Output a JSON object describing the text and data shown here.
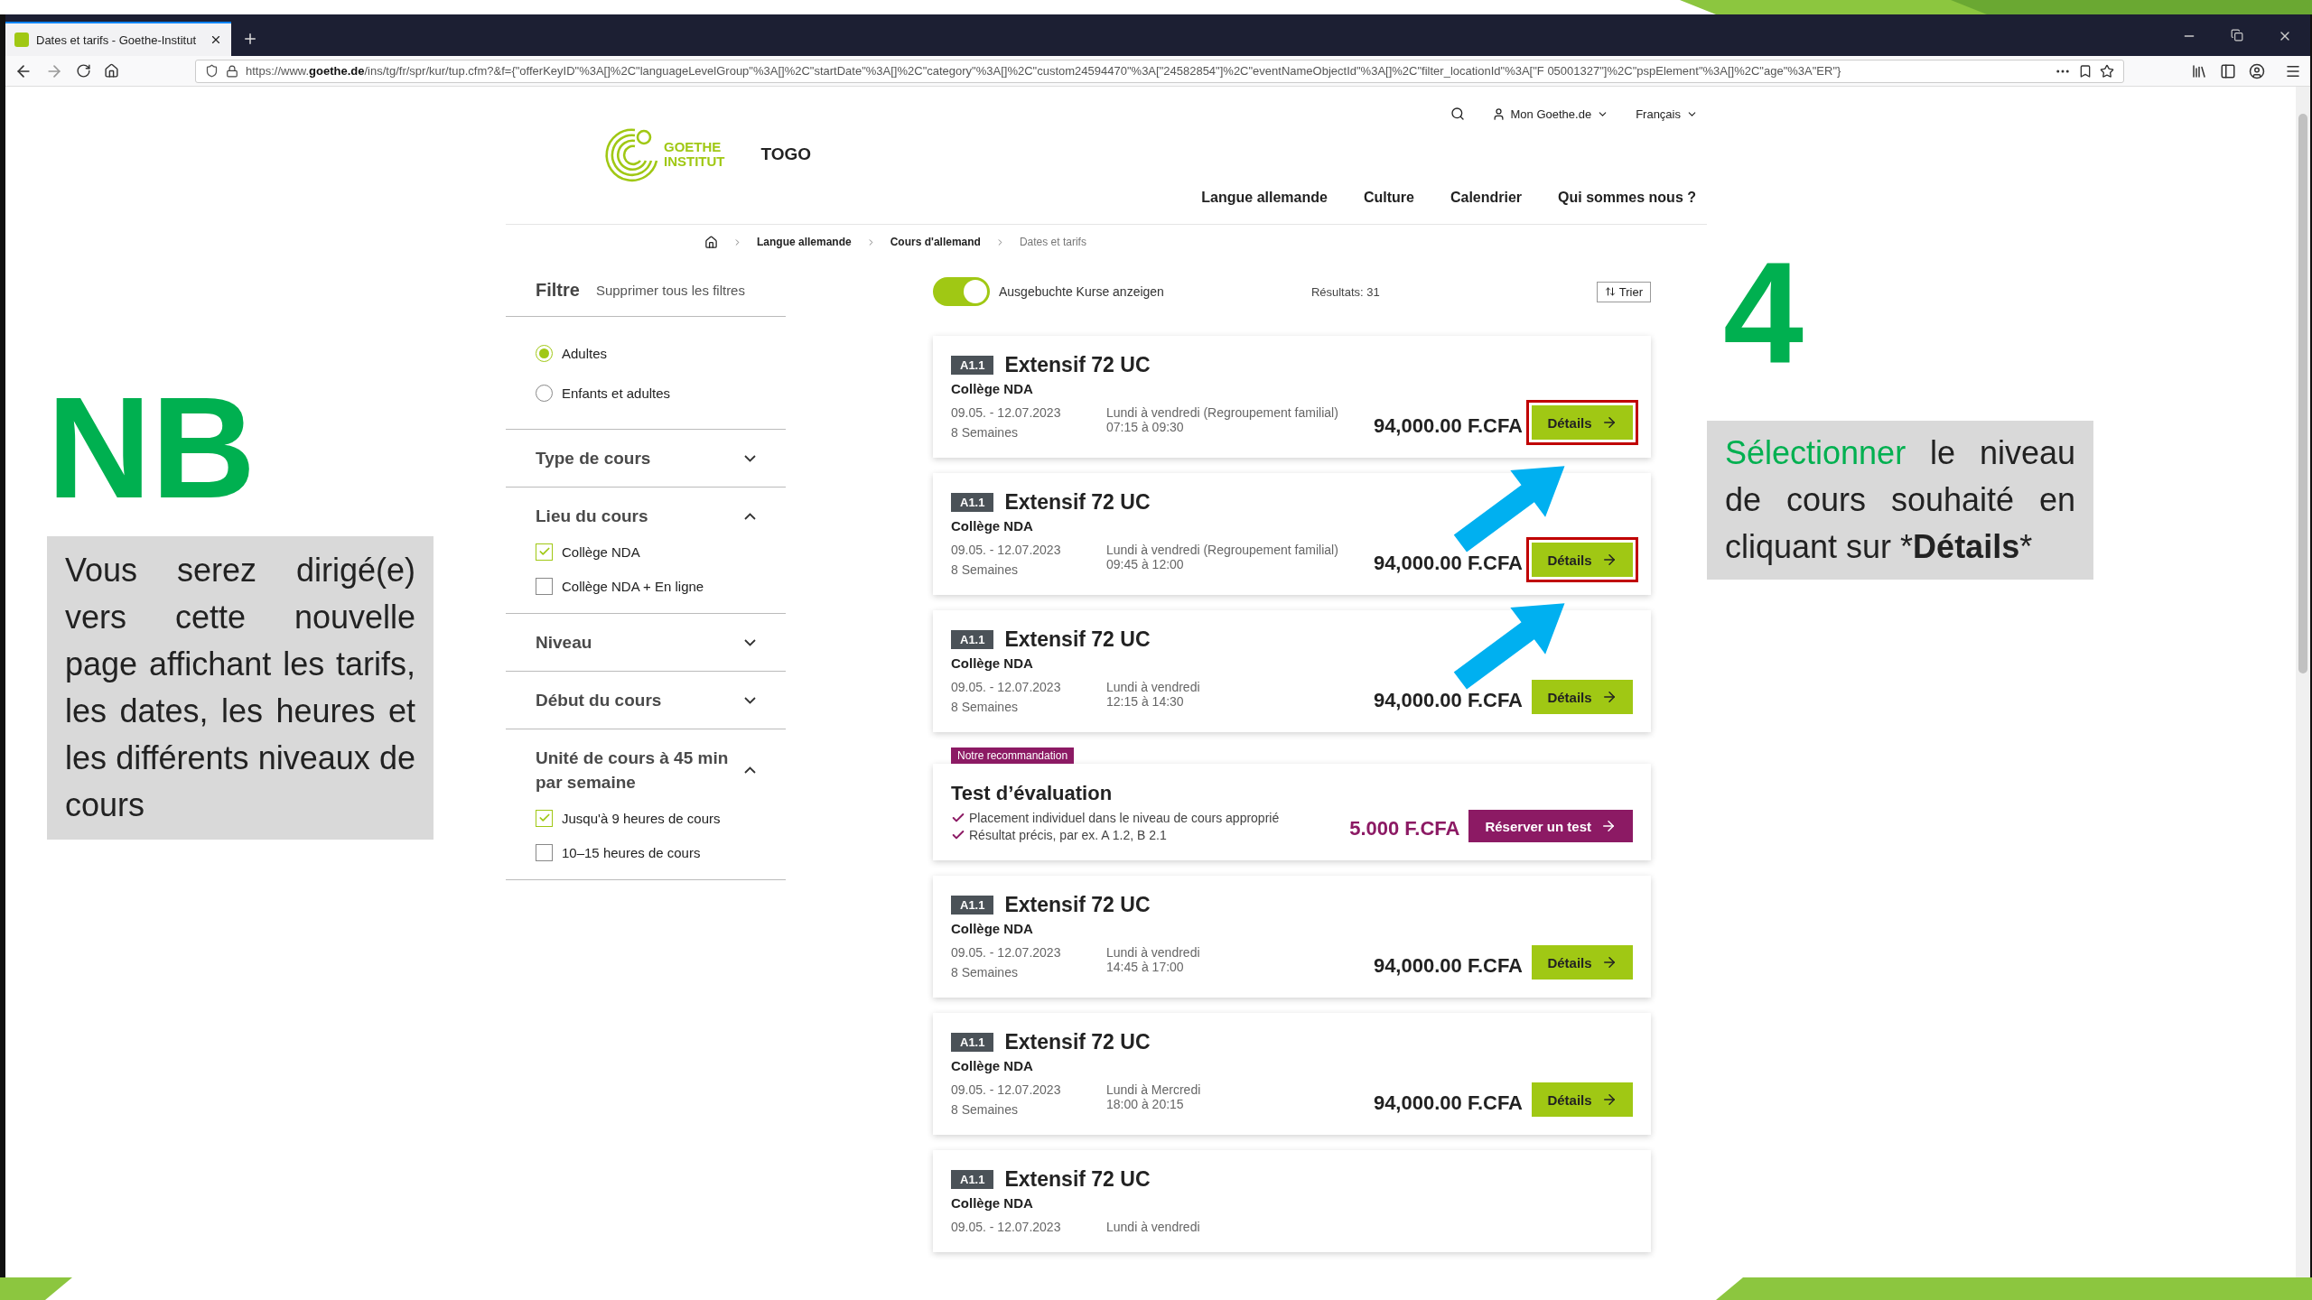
{
  "browser": {
    "tab_title": "Dates et tarifs - Goethe-Institut",
    "url": "https://www.**goethe.de**/ins/tg/fr/spr/kur/tup.cfm?&f={\"offerKeyID\"%3A[]%2C\"languageLevelGroup\"%3A[]%2C\"startDate\"%3A[]%2C\"category\"%3A[]%2C\"custom24594470\"%3A[\"24582854\"]%2C\"eventNameObjectId\"%3A[]%2C\"filter_locationId\"%3A[\"F 05001327\"]%2C\"pspElement\"%3A[]%2C\"age\"%3A\"ER\"}"
  },
  "site": {
    "logo": [
      "GOETHE",
      "INSTITUT"
    ],
    "country": "TOGO",
    "account": "Mon Goethe.de",
    "language": "Français",
    "nav": [
      "Langue allemande",
      "Culture",
      "Calendrier",
      "Qui sommes nous ?"
    ]
  },
  "breadcrumb": [
    "Langue allemande",
    "Cours d'allemand",
    "Dates et tarifs"
  ],
  "filters": {
    "title": "Filtre",
    "clear": "Supprimer tous les filtres",
    "audience": [
      {
        "label": "Adultes",
        "selected": true
      },
      {
        "label": "Enfants et adultes",
        "selected": false
      }
    ],
    "sections": [
      {
        "title": "Type de cours",
        "expanded": false
      },
      {
        "title": "Lieu du cours",
        "expanded": true,
        "options": [
          {
            "label": "Collège NDA",
            "checked": true
          },
          {
            "label": "Collège NDA + En ligne",
            "checked": false
          }
        ]
      },
      {
        "title": "Niveau",
        "expanded": false
      },
      {
        "title": "Début du cours",
        "expanded": false
      },
      {
        "title": "Unité de cours à 45 min par semaine",
        "expanded": true,
        "options": [
          {
            "label": "Jusqu'à 9 heures de cours",
            "checked": true
          },
          {
            "label": "10–15 heures de cours",
            "checked": false
          }
        ]
      }
    ]
  },
  "toolbar": {
    "toggle": {
      "label": "Ausgebuchte Kurse anzeigen",
      "on": true
    },
    "results": "Résultats: 31",
    "sort": "Trier"
  },
  "results": [
    {
      "kind": "course",
      "level": "A1.1",
      "title": "Extensif 72 UC",
      "location": "Collège NDA",
      "dates": "09.05. - 12.07.2023",
      "duration": "8 Semaines",
      "days": "Lundi à vendredi (Regroupement familial)",
      "time": "07:15 à 09:30",
      "price": "94,000.00 F.CFA",
      "button": "Détails",
      "highlighted": true
    },
    {
      "kind": "course",
      "level": "A1.1",
      "title": "Extensif 72 UC",
      "location": "Collège NDA",
      "dates": "09.05. - 12.07.2023",
      "duration": "8 Semaines",
      "days": "Lundi à vendredi (Regroupement familial)",
      "time": "09:45 à 12:00",
      "price": "94,000.00 F.CFA",
      "button": "Détails",
      "highlighted": true
    },
    {
      "kind": "course",
      "level": "A1.1",
      "title": "Extensif 72 UC",
      "location": "Collège NDA",
      "dates": "09.05. - 12.07.2023",
      "duration": "8 Semaines",
      "days": "Lundi à vendredi",
      "time": "12:15 à 14:30",
      "price": "94,000.00 F.CFA",
      "button": "Détails",
      "highlighted": false
    },
    {
      "kind": "test",
      "tag": "Notre recommandation",
      "title": "Test d’évaluation",
      "bullets": [
        "Placement individuel dans le niveau de cours approprié",
        "Résultat précis, par ex. A 1.2, B 2.1"
      ],
      "price": "5.000 F.CFA",
      "button": "Réserver un test"
    },
    {
      "kind": "course",
      "level": "A1.1",
      "title": "Extensif 72 UC",
      "location": "Collège NDA",
      "dates": "09.05. - 12.07.2023",
      "duration": "8 Semaines",
      "days": "Lundi à vendredi",
      "time": "14:45 à 17:00",
      "price": "94,000.00 F.CFA",
      "button": "Détails",
      "highlighted": false
    },
    {
      "kind": "course",
      "level": "A1.1",
      "title": "Extensif 72 UC",
      "location": "Collège NDA",
      "dates": "09.05. - 12.07.2023",
      "duration": "8 Semaines",
      "days": "Lundi à Mercredi",
      "time": "18:00 à 20:15",
      "price": "94,000.00 F.CFA",
      "button": "Détails",
      "highlighted": false
    },
    {
      "kind": "course",
      "level": "A1.1",
      "title": "Extensif 72 UC",
      "location": "Collège NDA",
      "dates": "09.05. - 12.07.2023",
      "days": "Lundi à vendredi"
    }
  ],
  "annotations": {
    "step": "4",
    "callout": {
      "lead": "Sélectionner",
      "before": "le niveau de cours souhaité en cliquant sur *",
      "emphasis": "Détails",
      "after": "*"
    },
    "note": {
      "title": "NB",
      "text": "Vous serez dirigé(e) vers cette nouvelle page affichant les tarifs, les dates, les heures et les différents niveaux de cours"
    }
  }
}
